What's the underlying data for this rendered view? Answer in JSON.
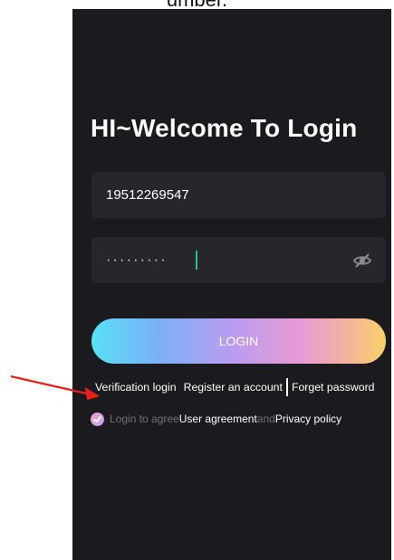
{
  "top_caption": "umber.",
  "login": {
    "title": "HI~Welcome To Login",
    "phone_value": "19512269547",
    "password_masked": "·········",
    "button_label": "LOGIN"
  },
  "links": {
    "verification_login": "Verification login",
    "register": "Register an account",
    "forget_password": "Forget password"
  },
  "agreement": {
    "prefix": "Login to agree",
    "user_agreement": "User agreement",
    "and": "and",
    "privacy_policy": "Privacy policy"
  },
  "icons": {
    "eye_toggle": "eye-slash-icon",
    "agree_check": "checkmark-icon",
    "annotation": "red-arrow"
  },
  "colors": {
    "background": "#1b1b1f",
    "field": "#26262c",
    "caret": "#25c38b",
    "annotation_arrow": "#e8211b"
  }
}
